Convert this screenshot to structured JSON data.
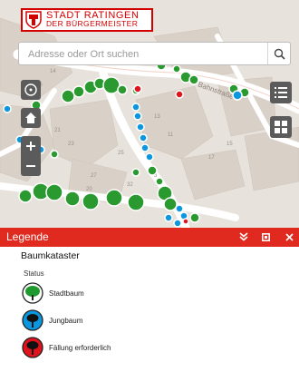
{
  "header": {
    "logo_line1": "STADT RATINGEN",
    "logo_line2": "DER BÜRGERMEISTER"
  },
  "search": {
    "placeholder": "Adresse oder Ort suchen"
  },
  "map": {
    "street_label": "Bahnstraße"
  },
  "legend": {
    "title": "Legende",
    "section_title": "Baumkataster",
    "status_label": "Status",
    "items": [
      {
        "label": "Stadtbaum",
        "color": "#1e9a2e"
      },
      {
        "label": "Jungbaum",
        "color": "#0a97e0"
      },
      {
        "label": "Fällung erforderlich",
        "color": "#e0121b"
      }
    ]
  },
  "colors": {
    "accent": "#e02a20",
    "control": "#5b5b5b"
  }
}
